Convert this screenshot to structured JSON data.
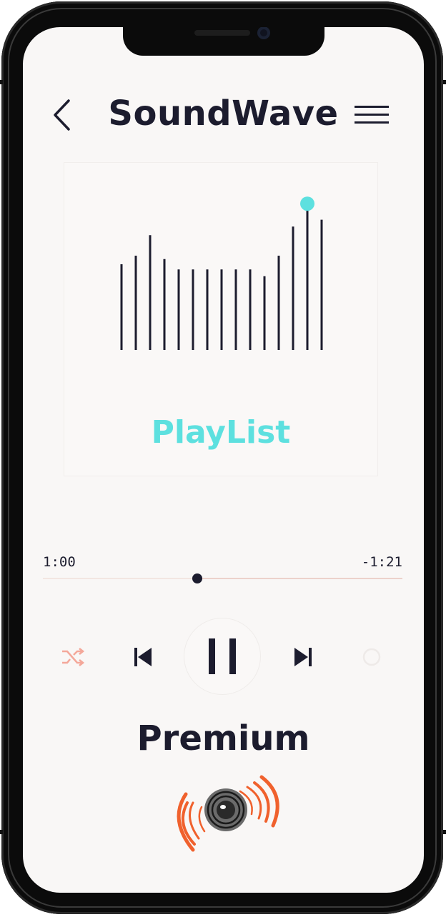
{
  "app": {
    "title": "SoundWave"
  },
  "header": {
    "back_icon": "chevron-left-icon",
    "menu_icon": "hamburger-menu-icon"
  },
  "visualizer": {
    "bar_levels": [
      0.5,
      0.55,
      0.67,
      0.53,
      0.47,
      0.47,
      0.47,
      0.47,
      0.47,
      0.47,
      0.43,
      0.55,
      0.72,
      0.82,
      0.76
    ],
    "active_bar_index": 13,
    "bar_color": "#1c1c2e",
    "marker_color": "#5de0df"
  },
  "playlist": {
    "label": "PlayList"
  },
  "player": {
    "elapsed": "1:00",
    "remaining": "-1:21",
    "progress_fraction": 0.43,
    "controls": {
      "shuffle_icon": "shuffle-icon",
      "previous_icon": "skip-previous-icon",
      "pause_icon": "pause-icon",
      "next_icon": "skip-next-icon",
      "repeat_icon": "repeat-icon"
    }
  },
  "plan": {
    "label": "Premium"
  },
  "colors": {
    "accent": "#5de0df",
    "text": "#1c1c2e",
    "shuffle": "#f4a89a",
    "logo_orange": "#f0612d",
    "screen_bg": "#f9f7f6"
  }
}
